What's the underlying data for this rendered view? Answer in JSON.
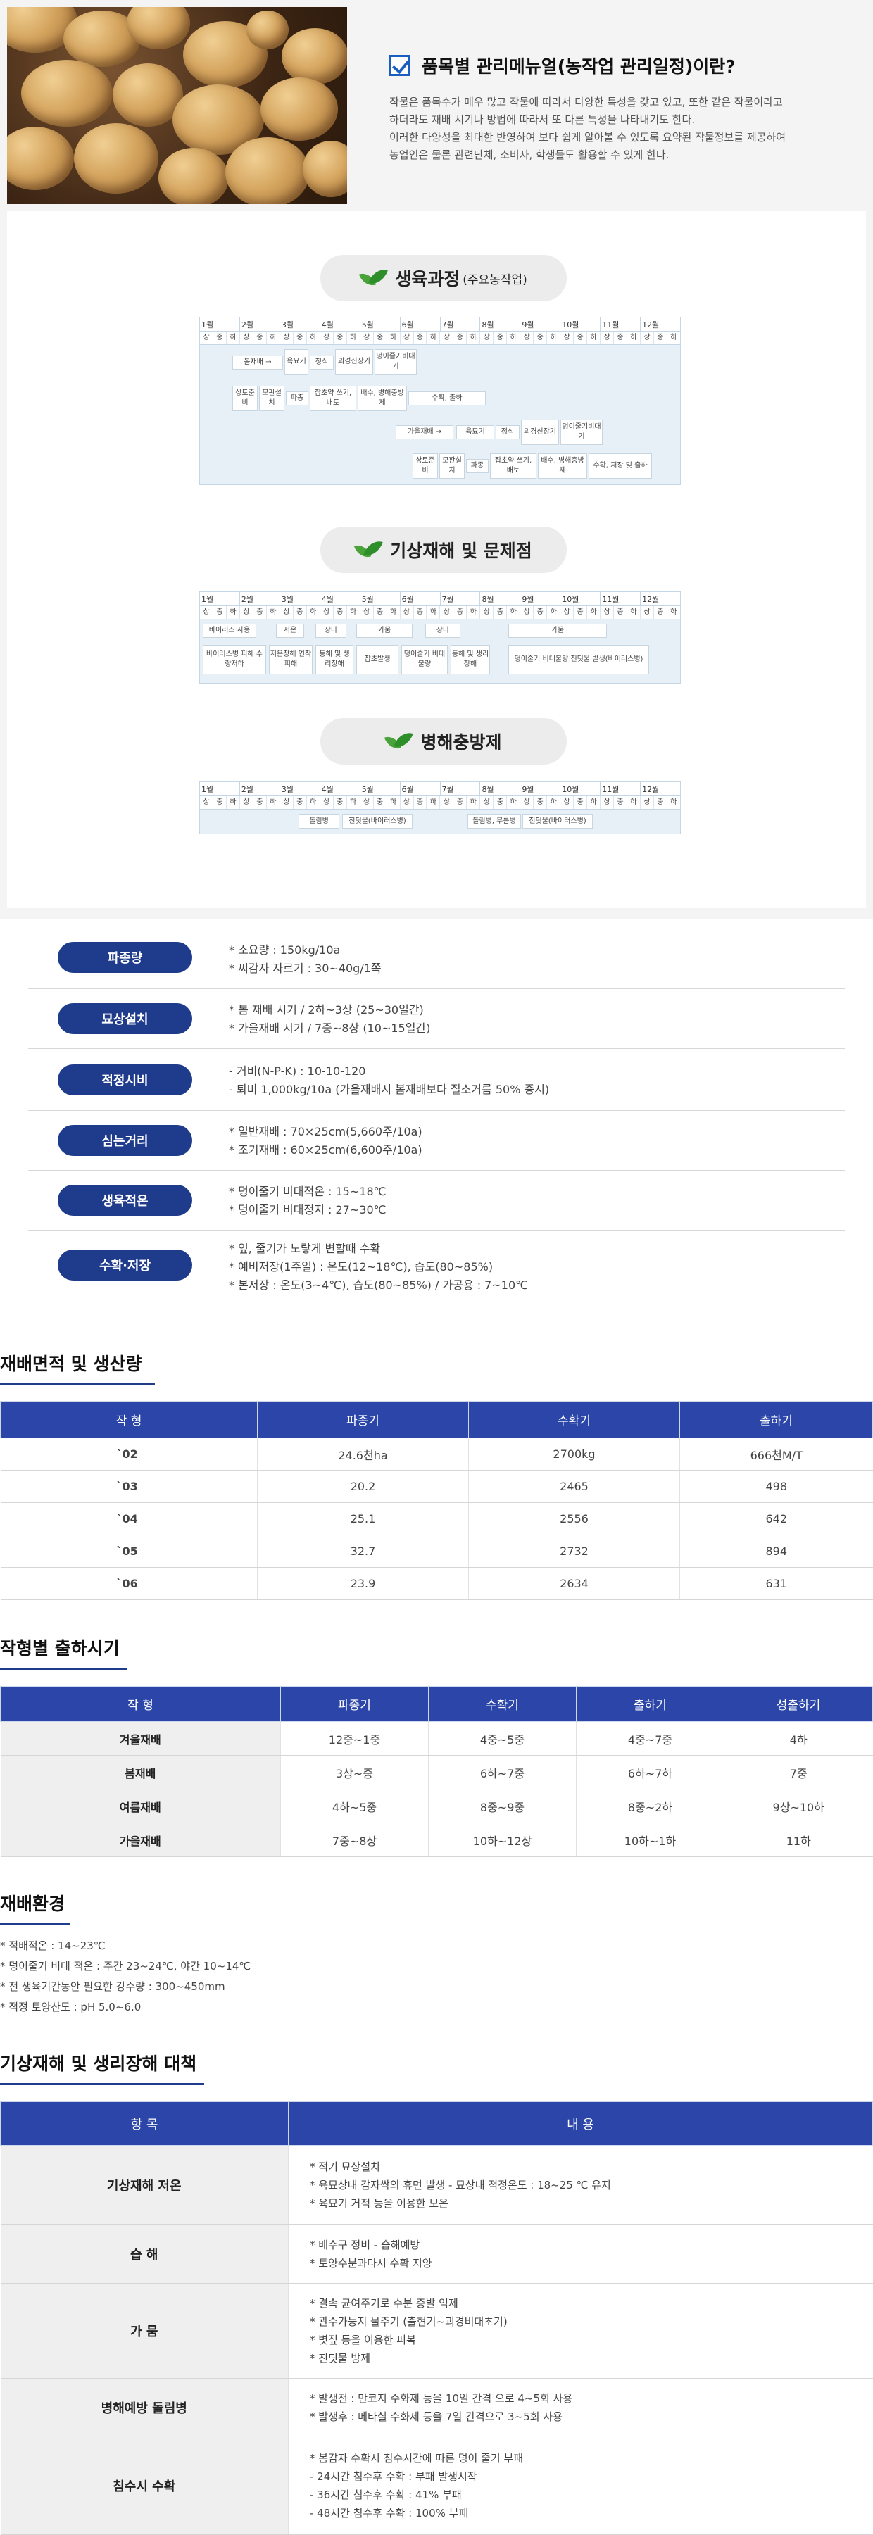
{
  "intro": {
    "title": "품목별 관리메뉴얼(농작업 관리일정)이란?",
    "lines": [
      "작물은 품목수가 매우 많고 작물에 따라서 다양한 특성을 갖고 있고, 또한 같은 작물이라고",
      "하더라도 재배 시기나 방법에 따라서 또 다른 특성을 나타내기도 한다.",
      "이러한 다양성을 최대한 반영하여 보다 쉽게 알아볼 수 있도록 요약된 작물정보를 제공하여",
      "농업인은 물론 관련단체, 소비자, 학생들도 활용할 수 있게 한다."
    ]
  },
  "schedule": {
    "growth_title": "생육과정",
    "growth_sub": "(주요농작업)",
    "disaster_title": "기상재해 및 문제점",
    "pest_title": "병해충방제",
    "months": [
      "1월",
      "2월",
      "3월",
      "4월",
      "5월",
      "6월",
      "7월",
      "8월",
      "9월",
      "10월",
      "11월",
      "12월"
    ],
    "subs": [
      "상",
      "중",
      "하"
    ],
    "growth_blocks": [
      "봄재배 →",
      "육묘기",
      "정식",
      "괴경신장기",
      "덩이줄기비대기",
      "상토준비",
      "모판설치",
      "파종",
      "잡초약 쓰기, 배토",
      "배수, 병해충방제",
      "수확, 출하",
      "가을재배 →",
      "육묘기",
      "정식",
      "괴경신장기",
      "덩이줄기비대기",
      "상토준비",
      "모판설치",
      "파종",
      "잡초약 쓰기, 배토",
      "배수, 병해충방제",
      "수확, 저장 및 출하"
    ],
    "disaster_blocks": [
      "바이러스 사용",
      "저온",
      "장마",
      "가뭄",
      "장마",
      "가뭄",
      "바이러스병 피해 수량저하",
      "저온장해 연작피해",
      "동해 및 생리장해",
      "잡초발생",
      "덩이줄기 비대불량",
      "동해 및 생리장해",
      "덩이줄기 비대불량 진딧물 발생(바이러스병)"
    ],
    "pest_blocks": [
      "돌림병",
      "진딧물(바이러스병)",
      "돌림병, 무름병",
      "진딧물(바이러스병)"
    ]
  },
  "info": [
    {
      "label": "파종량",
      "lines": [
        "* 소요량 : 150kg/10a",
        "* 씨감자 자르기 : 30~40g/1쪽"
      ]
    },
    {
      "label": "묘상설치",
      "lines": [
        "* 봄 재배 시기 / 2하~3상 (25~30일간)",
        "* 가을재배 시기 / 7중~8상 (10~15일간)"
      ]
    },
    {
      "label": "적정시비",
      "lines": [
        "- 거비(N-P-K) : 10-10-120",
        "- 퇴비 1,000kg/10a (가을재배시 봄재배보다 질소거름 50% 증시)"
      ]
    },
    {
      "label": "심는거리",
      "lines": [
        "* 일반재배 : 70×25cm(5,660주/10a)",
        "* 조기재배 : 60×25cm(6,600주/10a)"
      ]
    },
    {
      "label": "생육적온",
      "lines": [
        "* 덩이줄기 비대적온 : 15~18℃",
        "* 덩이줄기 비대정지 : 27~30℃"
      ]
    },
    {
      "label": "수확·저장",
      "lines": [
        "* 잎, 줄기가 노랗게 변할때 수확",
        "* 예비저장(1주일) : 온도(12~18℃), 습도(80~85%)",
        "* 본저장 : 온도(3~4℃), 습도(80~85%) / 가공용 : 7~10℃"
      ]
    }
  ],
  "area": {
    "title": "재배면적 및 생산량",
    "headers": [
      "작 형",
      "파종기",
      "수확기",
      "출하기"
    ],
    "rows": [
      [
        "`02",
        "24.6천ha",
        "2700kg",
        "666천M/T"
      ],
      [
        "`03",
        "20.2",
        "2465",
        "498"
      ],
      [
        "`04",
        "25.1",
        "2556",
        "642"
      ],
      [
        "`05",
        "32.7",
        "2732",
        "894"
      ],
      [
        "`06",
        "23.9",
        "2634",
        "631"
      ]
    ]
  },
  "period": {
    "title": "작형별 출하시기",
    "headers": [
      "작 형",
      "파종기",
      "수확기",
      "출하기",
      "성출하기"
    ],
    "rows": [
      [
        "겨울재배",
        "12중~1중",
        "4중~5중",
        "4중~7중",
        "4하"
      ],
      [
        "봄재배",
        "3상~중",
        "6하~7중",
        "6하~7하",
        "7중"
      ],
      [
        "여름재배",
        "4하~5중",
        "8중~9중",
        "8중~2하",
        "9상~10하"
      ],
      [
        "가을재배",
        "7중~8상",
        "10하~12상",
        "10하~1하",
        "11하"
      ]
    ]
  },
  "env": {
    "title": "재배환경",
    "lines": [
      "* 적배적온 : 14~23℃",
      "* 덩이줄기 비대 적온 : 주간 23~24℃, 야간 10~14℃",
      "* 전 생육기간동안 필요한 강수량 : 300~450mm",
      "* 적정 토양산도 : pH 5.0~6.0"
    ]
  },
  "countermeasures": {
    "title": "기상재해 및 생리장해 대책",
    "headers": [
      "항 목",
      "내 용"
    ],
    "rows": [
      {
        "label": "기상재해 저온",
        "lines": [
          "* 적기 묘상설치",
          "* 육묘상내 감자싹의 휴면 발생 - 묘상내 적정온도 : 18~25 ℃ 유지",
          "* 육묘기 거적 등을 이용한 보온"
        ]
      },
      {
        "label": "습 해",
        "lines": [
          "* 배수구 정비 - 습해예방",
          "* 토양수분과다시 수확 지양"
        ]
      },
      {
        "label": "가 뭄",
        "lines": [
          "* 결속 균여주기로 수분 증발 억제",
          "* 관수가능지 물주기 (출현기~괴경비대초기)",
          "* 볏짚 등을 이용한 피복",
          "* 진딧물 방제"
        ]
      },
      {
        "label": "병해예방 돌림병",
        "lines": [
          "* 발생전 : 만코지 수화제 등을 10일 간격 으로 4~5회 사용",
          "* 발생후 : 메타실 수화제 등을 7일 간격으로 3~5회 사용"
        ]
      },
      {
        "label": "침수시 수확",
        "lines": [
          "* 봄감자 수확시 침수시간에 따른 덩이 줄기 부패",
          "- 24시간 침수후 수확 : 부패 발생시작",
          "- 36시간 침수후 수확 : 41% 부패",
          "- 48시간 침수후 수확 : 100% 부패"
        ]
      }
    ]
  }
}
